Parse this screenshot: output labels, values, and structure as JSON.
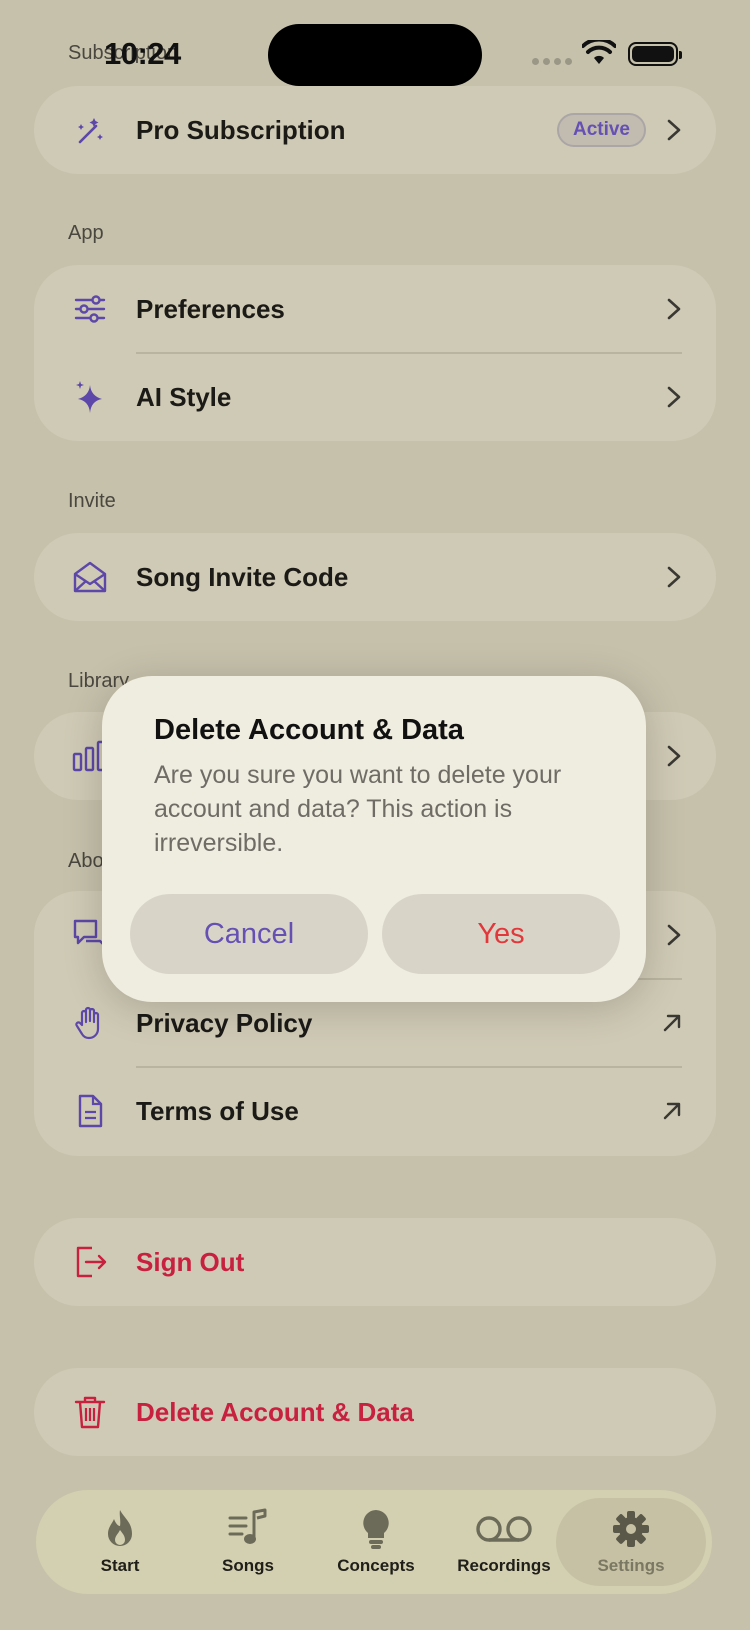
{
  "status_bar": {
    "time": "10:24"
  },
  "sections": {
    "subscription_label": "Subscription",
    "app_label": "App",
    "invite_label": "Invite",
    "library_label": "Library",
    "about_label": "About"
  },
  "rows": {
    "pro_subscription": {
      "label": "Pro Subscription",
      "badge": "Active"
    },
    "preferences": {
      "label": "Preferences"
    },
    "ai_style": {
      "label": "AI Style"
    },
    "song_invite_code": {
      "label": "Song Invite Code"
    },
    "privacy_policy": {
      "label": "Privacy Policy"
    },
    "terms_of_use": {
      "label": "Terms of Use"
    },
    "sign_out": {
      "label": "Sign Out"
    },
    "delete_account": {
      "label": "Delete Account & Data"
    }
  },
  "dialog": {
    "title": "Delete Account & Data",
    "message": "Are you sure you want to delete your account and data? This action is irreversible.",
    "cancel_label": "Cancel",
    "confirm_label": "Yes"
  },
  "tabbar": {
    "tabs": [
      {
        "label": "Start",
        "icon": "flame-icon"
      },
      {
        "label": "Songs",
        "icon": "music-list-icon"
      },
      {
        "label": "Concepts",
        "icon": "lightbulb-icon"
      },
      {
        "label": "Recordings",
        "icon": "voicemail-icon"
      },
      {
        "label": "Settings",
        "icon": "gear-icon"
      }
    ],
    "active": "Settings"
  },
  "colors": {
    "accent": "#6650b3",
    "destructive": "#c8203f",
    "background": "#c6c1ab",
    "card": "#cfcab5"
  }
}
